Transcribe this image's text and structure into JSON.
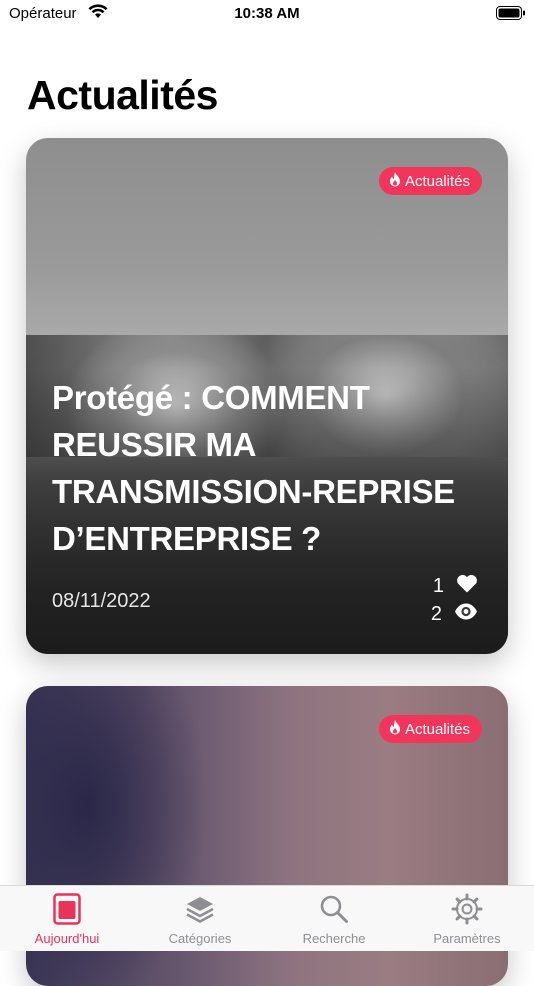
{
  "status_bar": {
    "carrier": "Opérateur",
    "time": "10:38 AM"
  },
  "page": {
    "title": "Actualités"
  },
  "cards": [
    {
      "badge": "Actualités",
      "title": "Protégé : COMMENT REUSSIR MA TRANSMISSION-REPRISE D’ENTREPRISE ?",
      "date": "08/11/2022",
      "likes": "1",
      "views": "2"
    },
    {
      "badge": "Actualités"
    }
  ],
  "tabbar": {
    "items": [
      {
        "label": "Aujourd'hui",
        "icon": "today-icon",
        "active": true
      },
      {
        "label": "Catégories",
        "icon": "layers-icon"
      },
      {
        "label": "Recherche",
        "icon": "search-icon"
      },
      {
        "label": "Paramètres",
        "icon": "gear-icon"
      }
    ]
  },
  "colors": {
    "accent": "#f2355a",
    "tab_active": "#e8335a",
    "tab_inactive": "#8e8e93"
  }
}
